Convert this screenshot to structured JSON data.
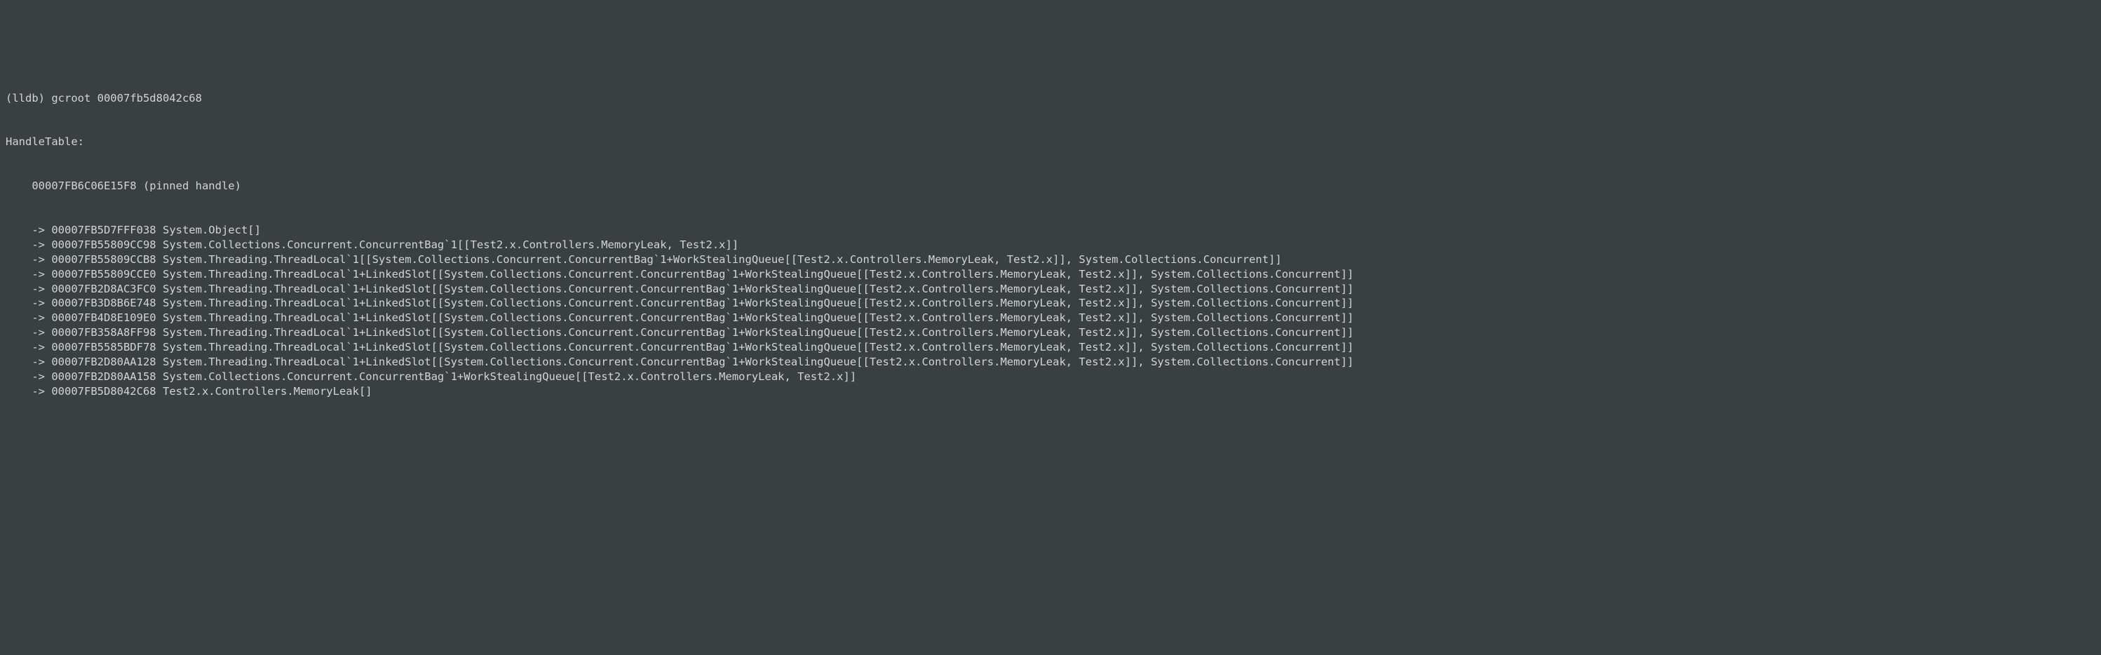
{
  "terminal": {
    "prompt": "(lldb) gcroot 00007fb5d8042c68",
    "header": "HandleTable:",
    "root_indent": "    ",
    "root": "00007FB6C06E15F8 (pinned handle)",
    "chain_indent": "    -> ",
    "continuation_indent": ", ",
    "chain": [
      {
        "addr": "00007FB5D7FFF038",
        "type": "System.Object[]"
      },
      {
        "addr": "00007FB55809CC98",
        "type": "System.Collections.Concurrent.ConcurrentBag`1[[Test2.x.Controllers.MemoryLeak, Test2.x]]"
      },
      {
        "addr": "00007FB55809CCB8",
        "type": "System.Threading.ThreadLocal`1[[System.Collections.Concurrent.ConcurrentBag`1+WorkStealingQueue[[Test2.x.Controllers.MemoryLeak, Test2.x]], System.Collections.Concurrent]]"
      },
      {
        "addr": "00007FB55809CCE0",
        "type": "System.Threading.ThreadLocal`1+LinkedSlot[[System.Collections.Concurrent.ConcurrentBag`1+WorkStealingQueue[[Test2.x.Controllers.MemoryLeak, Test2.x]], System.Collections.Concurrent]]"
      },
      {
        "addr": "00007FB2D8AC3FC0",
        "type": "System.Threading.ThreadLocal`1+LinkedSlot[[System.Collections.Concurrent.ConcurrentBag`1+WorkStealingQueue[[Test2.x.Controllers.MemoryLeak, Test2.x]], System.Collections.Concurrent]]"
      },
      {
        "addr": "00007FB3D8B6E748",
        "type": "System.Threading.ThreadLocal`1+LinkedSlot[[System.Collections.Concurrent.ConcurrentBag`1+WorkStealingQueue[[Test2.x.Controllers.MemoryLeak, Test2.x]], System.Collections.Concurrent]]"
      },
      {
        "addr": "00007FB4D8E109E0",
        "type": "System.Threading.ThreadLocal`1+LinkedSlot[[System.Collections.Concurrent.ConcurrentBag`1+WorkStealingQueue[[Test2.x.Controllers.MemoryLeak, Test2.x]], System.Collections.Concurrent]]"
      },
      {
        "addr": "00007FB358A8FF98",
        "type": "System.Threading.ThreadLocal`1+LinkedSlot[[System.Collections.Concurrent.ConcurrentBag`1+WorkStealingQueue[[Test2.x.Controllers.MemoryLeak, Test2.x]], System.Collections.Concurrent]]"
      },
      {
        "addr": "00007FB5585BDF78",
        "type": "System.Threading.ThreadLocal`1+LinkedSlot[[System.Collections.Concurrent.ConcurrentBag`1+WorkStealingQueue[[Test2.x.Controllers.MemoryLeak, Test2.x]], System.Collections.Concurrent]]"
      },
      {
        "addr": "00007FB2D80AA128",
        "type": "System.Threading.ThreadLocal`1+LinkedSlot[[System.Collections.Concurrent.ConcurrentBag`1+WorkStealingQueue[[Test2.x.Controllers.MemoryLeak, Test2.x]], System.Collections.Concurrent]]"
      },
      {
        "addr": "00007FB2D80AA158",
        "type": "System.Collections.Concurrent.ConcurrentBag`1+WorkStealingQueue[[Test2.x.Controllers.MemoryLeak, Test2.x]]"
      },
      {
        "addr": "00007FB5D8042C68",
        "type": "Test2.x.Controllers.MemoryLeak[]"
      }
    ]
  }
}
